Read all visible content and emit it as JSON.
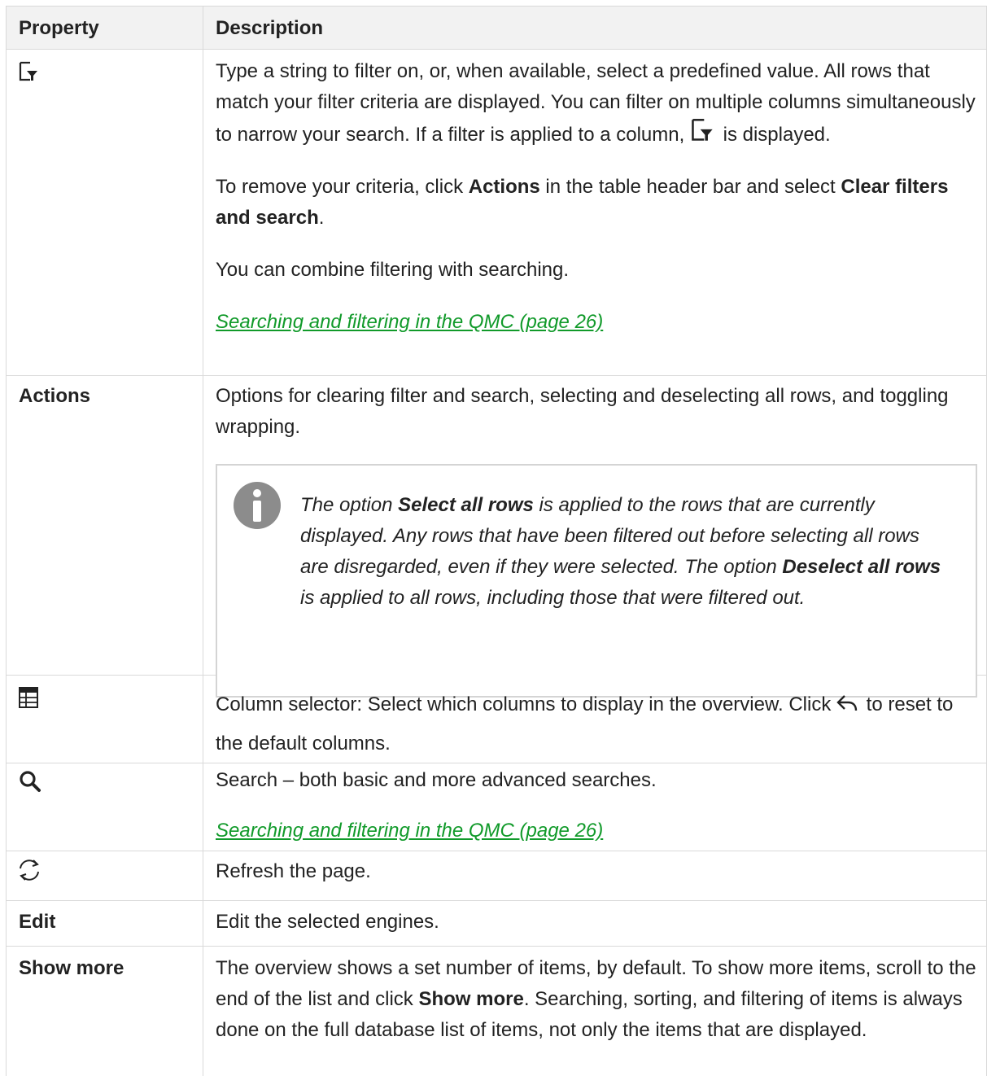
{
  "table": {
    "header": {
      "property": "Property",
      "description": "Description"
    },
    "filter_row": {
      "icon": "filter-icon",
      "p1_before_icon": "Type a string to filter on, or, when available, select a predefined value. All rows that match your filter criteria are displayed. You can filter on multiple columns simultaneously to narrow your search. If a filter is applied to a column,",
      "p1_after_icon": " is displayed.",
      "p2_before": "To remove your criteria, click ",
      "p2_bold1": "Actions",
      "p2_mid": " in the table header bar and select ",
      "p2_bold2": "Clear filters and search",
      "p2_end": ".",
      "p3": "You can combine filtering with searching.",
      "link": " Searching and filtering in the QMC (page 26)"
    },
    "actions_row": {
      "property": "Actions",
      "description": "Options for clearing filter and search, selecting and deselecting all rows, and toggling wrapping.",
      "note": {
        "icon": "info-icon",
        "t1": "The option ",
        "b1": "Select all rows",
        "t2": " is applied to the rows that are currently displayed. Any rows that have been filtered out before selecting all rows are disregarded, even if they were selected. The option ",
        "b2": "Deselect all rows",
        "t3": " is applied to all rows, including those that were filtered out."
      }
    },
    "columns_row": {
      "icon": "column-selector-icon",
      "before_icon": "Column selector: Select which columns to display in the overview. Click",
      "reset_icon": "undo-arrow-icon",
      "after_icon": " to reset to the default columns."
    },
    "search_row": {
      "icon": "search-icon",
      "description": "Search – both basic and more advanced searches.",
      "link": " Searching and filtering in the QMC (page 26)"
    },
    "refresh_row": {
      "icon": "refresh-icon",
      "description": "Refresh the page."
    },
    "edit_row": {
      "property": "Edit",
      "description": "Edit the selected engines."
    },
    "show_more_row": {
      "property": "Show more",
      "d_before": "The overview shows a set number of items, by default. To show more items, scroll to the end of the list and click ",
      "d_bold": "Show more",
      "d_after": ". Searching, sorting, and filtering of items is always done on the full database list of items, not only the items that are displayed."
    }
  }
}
